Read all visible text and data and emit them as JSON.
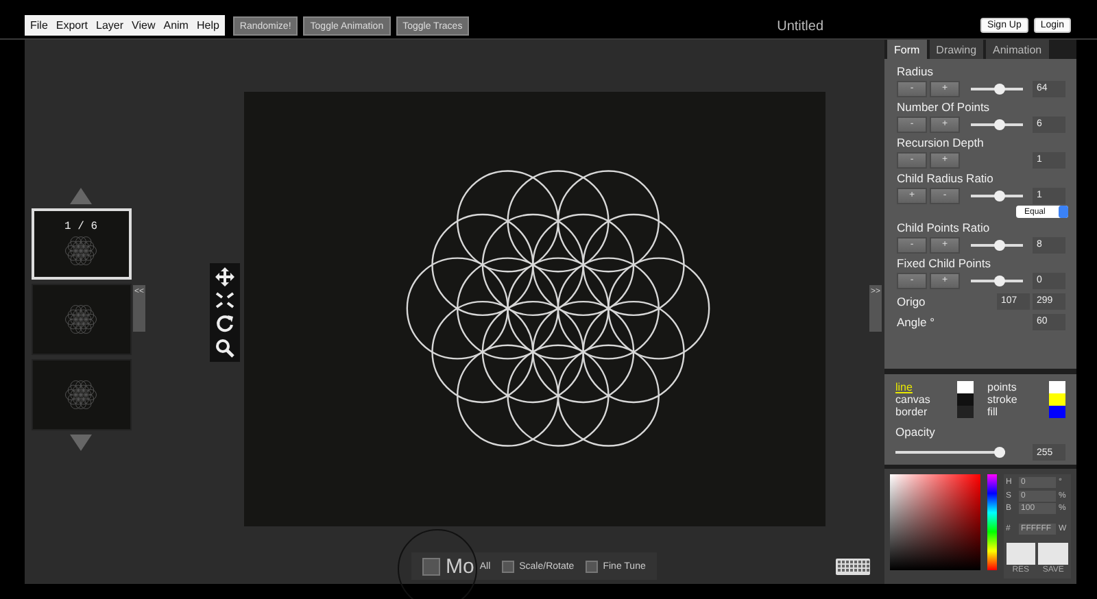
{
  "menu": [
    "File",
    "Export",
    "Layer",
    "View",
    "Anim",
    "Help"
  ],
  "toolbar_buttons": [
    "Randomize!",
    "Toggle Animation",
    "Toggle Traces"
  ],
  "title": "Untitled",
  "auth_buttons": [
    "Sign Up",
    "Login"
  ],
  "thumbnails": {
    "counter": "1 / 6",
    "items": [
      {
        "selected": true
      },
      {
        "selected": false
      },
      {
        "selected": false
      }
    ]
  },
  "collapse_left": "<<",
  "collapse_right": ">>",
  "tabs": [
    {
      "label": "Form",
      "selected": true
    },
    {
      "label": "Drawing",
      "selected": false
    },
    {
      "label": "Animation",
      "selected": false
    }
  ],
  "params": [
    {
      "kind": "slider",
      "label": "Radius",
      "buttons": [
        "-",
        "+"
      ],
      "level": 0.55,
      "value": "64"
    },
    {
      "kind": "slider",
      "label": "Number Of Points",
      "buttons": [
        "-",
        "+"
      ],
      "level": 0.55,
      "value": "6"
    },
    {
      "kind": "stepper",
      "label": "Recursion Depth",
      "buttons": [
        "-",
        "+"
      ],
      "value": "1"
    },
    {
      "kind": "slider",
      "label": "Child Radius Ratio",
      "buttons": [
        "+",
        "-"
      ],
      "level": 0.55,
      "value": "1",
      "select": "Equal"
    },
    {
      "kind": "slider",
      "label": "Child Points Ratio",
      "buttons": [
        "-",
        "+"
      ],
      "level": 0.55,
      "value": "8"
    },
    {
      "kind": "slider",
      "label": "Fixed Child Points",
      "buttons": [
        "-",
        "+"
      ],
      "level": 0.55,
      "value": "0"
    },
    {
      "kind": "pair",
      "label": "Origo",
      "values": [
        "107",
        "299"
      ]
    },
    {
      "kind": "single",
      "label": "Angle °",
      "values": [
        "60"
      ]
    }
  ],
  "colors": [
    {
      "label": "line",
      "selected": true,
      "color": "#ffffff"
    },
    {
      "label": "points",
      "selected": false,
      "color": "#ffffff"
    },
    {
      "label": "canvas",
      "selected": false,
      "color": "#111111"
    },
    {
      "label": "stroke",
      "selected": false,
      "color": "#ffff00"
    },
    {
      "label": "border",
      "selected": false,
      "color": "#222222"
    },
    {
      "label": "fill",
      "selected": false,
      "color": "#0000ff"
    }
  ],
  "opacity": {
    "label": "Opacity",
    "level": 0.95,
    "value": "255"
  },
  "picker": {
    "fields": [
      {
        "label": "H",
        "value": "0",
        "unit": "°"
      },
      {
        "label": "S",
        "value": "0",
        "unit": "%"
      },
      {
        "label": "B",
        "value": "100",
        "unit": "%"
      }
    ],
    "hex_label": "#",
    "hex": "FFFFFF",
    "hex_button": "W",
    "buttons": [
      "RES",
      "SAVE"
    ]
  },
  "bottom_options": [
    {
      "label_magnified": "Mo",
      "label": "All",
      "checked": false
    },
    {
      "label": "Scale/Rotate",
      "checked": false
    },
    {
      "label": "Fine Tune",
      "checked": false
    }
  ]
}
